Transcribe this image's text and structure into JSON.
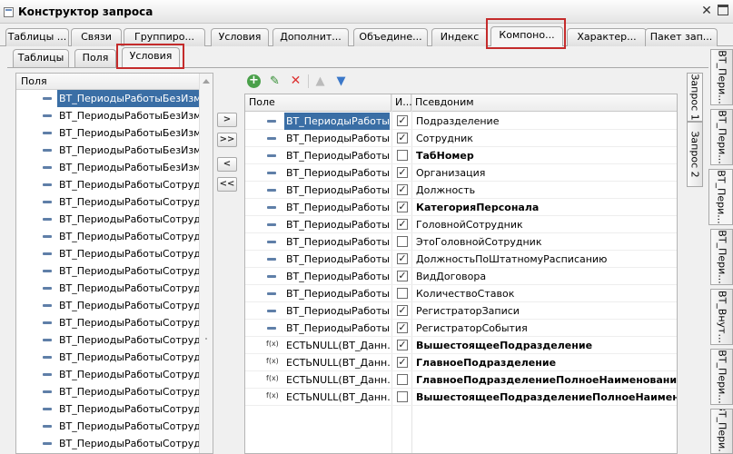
{
  "window": {
    "title": "Конструктор запроса"
  },
  "top_tabs": [
    "Таблицы ...",
    "Связи",
    "Группиро...",
    "Условия",
    "Дополнит...",
    "Объедине...",
    "Индекс",
    "Компоно...",
    "Характер...",
    "Пакет зап..."
  ],
  "active_top_tab": "Компоно...",
  "sub_tabs": [
    "Таблицы",
    "Поля",
    "Условия"
  ],
  "active_sub_tab": "Условия",
  "left_panel": {
    "header": "Поля",
    "items": [
      "ВТ_ПериодыРаботыБезИзмен",
      "ВТ_ПериодыРаботыБезИзмен",
      "ВТ_ПериодыРаботыБезИзмен",
      "ВТ_ПериодыРаботыБезИзмен",
      "ВТ_ПериодыРаботыБезИзмен",
      "ВТ_ПериодыРаботыСотрудник",
      "ВТ_ПериодыРаботыСотрудник",
      "ВТ_ПериодыРаботыСотрудник",
      "ВТ_ПериодыРаботыСотрудник",
      "ВТ_ПериодыРаботыСотрудник",
      "ВТ_ПериодыРаботыСотрудник",
      "ВТ_ПериодыРаботыСотрудник",
      "ВТ_ПериодыРаботыСотрудник",
      "ВТ_ПериодыРаботыСотрудник",
      "ВТ_ПериодыРаботыСотрудник",
      "ВТ_ПериодыРаботыСотрудник",
      "ВТ_ПериодыРаботыСотрудник",
      "ВТ_ПериодыРаботыСотрудник",
      "ВТ_ПериодыРаботыСотрудник",
      "ВТ_ПериодыРаботыСотрудник",
      "ВТ_ПериодыРаботыСотрудник"
    ]
  },
  "move_buttons": [
    ">",
    ">>",
    "<",
    "<<"
  ],
  "grid": {
    "columns": [
      "Поле",
      "И...",
      "Псевдоним"
    ],
    "rows": [
      {
        "field": "ВТ_ПериодыРаботы...",
        "icon": "field",
        "checked": true,
        "alias": "Подразделение",
        "bold": false
      },
      {
        "field": "ВТ_ПериодыРаботы...",
        "icon": "field",
        "checked": true,
        "alias": "Сотрудник",
        "bold": false
      },
      {
        "field": "ВТ_ПериодыРаботы...",
        "icon": "field",
        "checked": false,
        "alias": "ТабНомер",
        "bold": true
      },
      {
        "field": "ВТ_ПериодыРаботы...",
        "icon": "field",
        "checked": true,
        "alias": "Организация",
        "bold": false
      },
      {
        "field": "ВТ_ПериодыРаботы...",
        "icon": "field",
        "checked": true,
        "alias": "Должность",
        "bold": false
      },
      {
        "field": "ВТ_ПериодыРаботы...",
        "icon": "field",
        "checked": true,
        "alias": "КатегорияПерсонала",
        "bold": true
      },
      {
        "field": "ВТ_ПериодыРаботы...",
        "icon": "field",
        "checked": true,
        "alias": "ГоловнойСотрудник",
        "bold": false
      },
      {
        "field": "ВТ_ПериодыРаботы...",
        "icon": "field",
        "checked": false,
        "alias": "ЭтоГоловнойСотрудник",
        "bold": false
      },
      {
        "field": "ВТ_ПериодыРаботы...",
        "icon": "field",
        "checked": true,
        "alias": "ДолжностьПоШтатномуРасписанию",
        "bold": false
      },
      {
        "field": "ВТ_ПериодыРаботы...",
        "icon": "field",
        "checked": true,
        "alias": "ВидДоговора",
        "bold": false
      },
      {
        "field": "ВТ_ПериодыРаботы...",
        "icon": "field",
        "checked": false,
        "alias": "КоличествоСтавок",
        "bold": false
      },
      {
        "field": "ВТ_ПериодыРаботы...",
        "icon": "field",
        "checked": true,
        "alias": "РегистраторЗаписи",
        "bold": false
      },
      {
        "field": "ВТ_ПериодыРаботы...",
        "icon": "field",
        "checked": true,
        "alias": "РегистраторСобытия",
        "bold": false
      },
      {
        "field": "ЕСТЬNULL(ВТ_Данн...",
        "icon": "function",
        "checked": true,
        "alias": "ВышестоящееПодразделение",
        "bold": true
      },
      {
        "field": "ЕСТЬNULL(ВТ_Данн...",
        "icon": "function",
        "checked": true,
        "alias": "ГлавноеПодразделение",
        "bold": true
      },
      {
        "field": "ЕСТЬNULL(ВТ_Данн...",
        "icon": "function",
        "checked": false,
        "alias": "ГлавноеПодразделениеПолноеНаименование",
        "bold": true
      },
      {
        "field": "ЕСТЬNULL(ВТ_Данн...",
        "icon": "function",
        "checked": false,
        "alias": "ВышестоящееПодразделениеПолноеНаименование",
        "bold": true
      }
    ],
    "function_icon_text": "f(x)"
  },
  "query_tabs": [
    "Запрос 1",
    "Запрос 2"
  ],
  "right_tabs": [
    "ВТ_Пери...",
    "ВТ_Пери...",
    "ВТ_Пери...",
    "ВТ_Пери...",
    "ВТ_Внут...",
    "ВТ_Пери...",
    "ВТ_Пери..."
  ],
  "active_right_tab_index": 2,
  "colors": {
    "selection": "#3a6ea5",
    "highlight": "#c42b2b",
    "field_icon": "#5f7fa8"
  }
}
